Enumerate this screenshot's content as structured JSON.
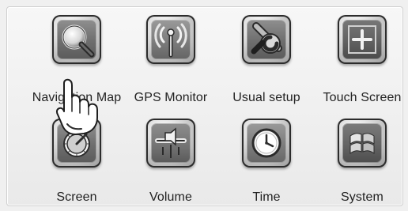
{
  "menu": {
    "items": [
      {
        "label": "Navigation Map",
        "icon": "magnifier-icon"
      },
      {
        "label": "GPS Monitor",
        "icon": "antenna-icon"
      },
      {
        "label": "Usual setup",
        "icon": "wrench-icon"
      },
      {
        "label": "Touch Screen",
        "icon": "touch-crosshair-icon"
      },
      {
        "label": "Screen",
        "icon": "brightness-dial-icon"
      },
      {
        "label": "Volume",
        "icon": "volume-slider-icon"
      },
      {
        "label": "Time",
        "icon": "clock-icon"
      },
      {
        "label": "System",
        "icon": "windows-logo-icon"
      }
    ]
  },
  "overlay": {
    "cursor": "hand-pointer-icon"
  }
}
